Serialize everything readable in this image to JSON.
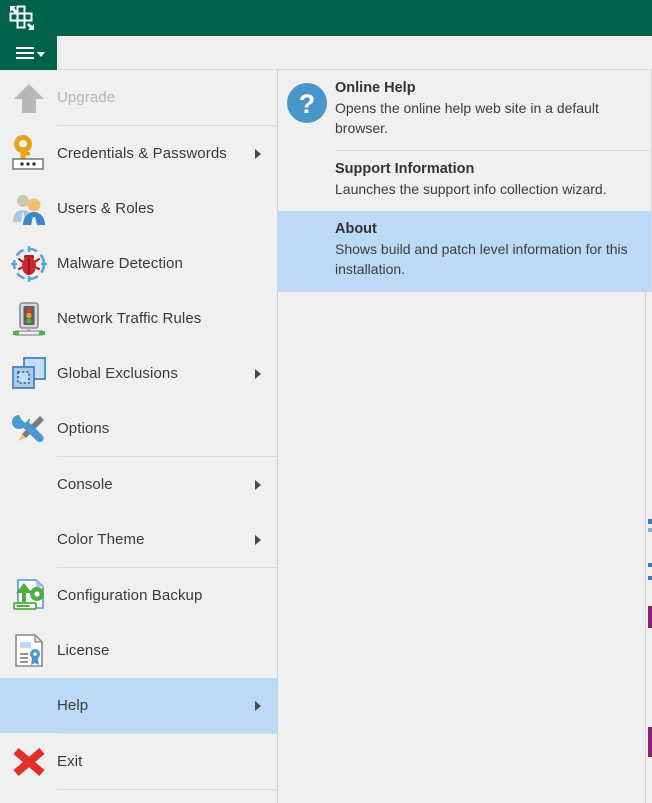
{
  "window": {
    "app_logo_icon": "veeam-logo-icon",
    "titlebar_color": "#00624a",
    "highlight_color": "#bbdaf7",
    "background_color": "#f0f0f0"
  },
  "toolbar": {
    "main_menu_icon": "hamburger-menu-icon",
    "caret_icon": "caret-down-icon"
  },
  "main_menu": {
    "items": [
      {
        "id": "upgrade",
        "label": "Upgrade",
        "icon": "up-arrow-icon",
        "disabled": true,
        "submenu": false,
        "selected": false
      },
      {
        "id": "credentials",
        "label": "Credentials & Passwords",
        "icon": "key-password-icon",
        "disabled": false,
        "submenu": true,
        "selected": false
      },
      {
        "id": "users-roles",
        "label": "Users & Roles",
        "icon": "users-icon",
        "disabled": false,
        "submenu": false,
        "selected": false
      },
      {
        "id": "malware-detection",
        "label": "Malware Detection",
        "icon": "bug-crosshair-icon",
        "disabled": false,
        "submenu": false,
        "selected": false
      },
      {
        "id": "network-traffic-rules",
        "label": "Network Traffic Rules",
        "icon": "traffic-light-icon",
        "disabled": false,
        "submenu": false,
        "selected": false
      },
      {
        "id": "global-exclusions",
        "label": "Global Exclusions",
        "icon": "exclusion-squares-icon",
        "disabled": false,
        "submenu": true,
        "selected": false
      },
      {
        "id": "options",
        "label": "Options",
        "icon": "wrench-screwdriver-icon",
        "disabled": false,
        "submenu": false,
        "selected": false
      },
      {
        "id": "console",
        "label": "Console",
        "icon": "none",
        "disabled": false,
        "submenu": true,
        "selected": false
      },
      {
        "id": "color-theme",
        "label": "Color Theme",
        "icon": "none",
        "disabled": false,
        "submenu": true,
        "selected": false
      },
      {
        "id": "configuration-backup",
        "label": "Configuration Backup",
        "icon": "config-backup-icon",
        "disabled": false,
        "submenu": false,
        "selected": false
      },
      {
        "id": "license",
        "label": "License",
        "icon": "license-document-icon",
        "disabled": false,
        "submenu": false,
        "selected": false
      },
      {
        "id": "help",
        "label": "Help",
        "icon": "none",
        "disabled": false,
        "submenu": true,
        "selected": true
      },
      {
        "id": "exit",
        "label": "Exit",
        "icon": "red-x-icon",
        "disabled": false,
        "submenu": false,
        "selected": false
      }
    ]
  },
  "help_submenu": {
    "items": [
      {
        "id": "online-help",
        "title": "Online Help",
        "description": "Opens the online help web site in a default browser.",
        "icon": "question-mark-circle-icon",
        "selected": false
      },
      {
        "id": "support-information",
        "title": "Support Information",
        "description": "Launches the support info collection wizard.",
        "icon": "none",
        "selected": false
      },
      {
        "id": "about",
        "title": "About",
        "description": "Shows build and patch level information for this installation.",
        "icon": "none",
        "selected": true
      }
    ]
  }
}
